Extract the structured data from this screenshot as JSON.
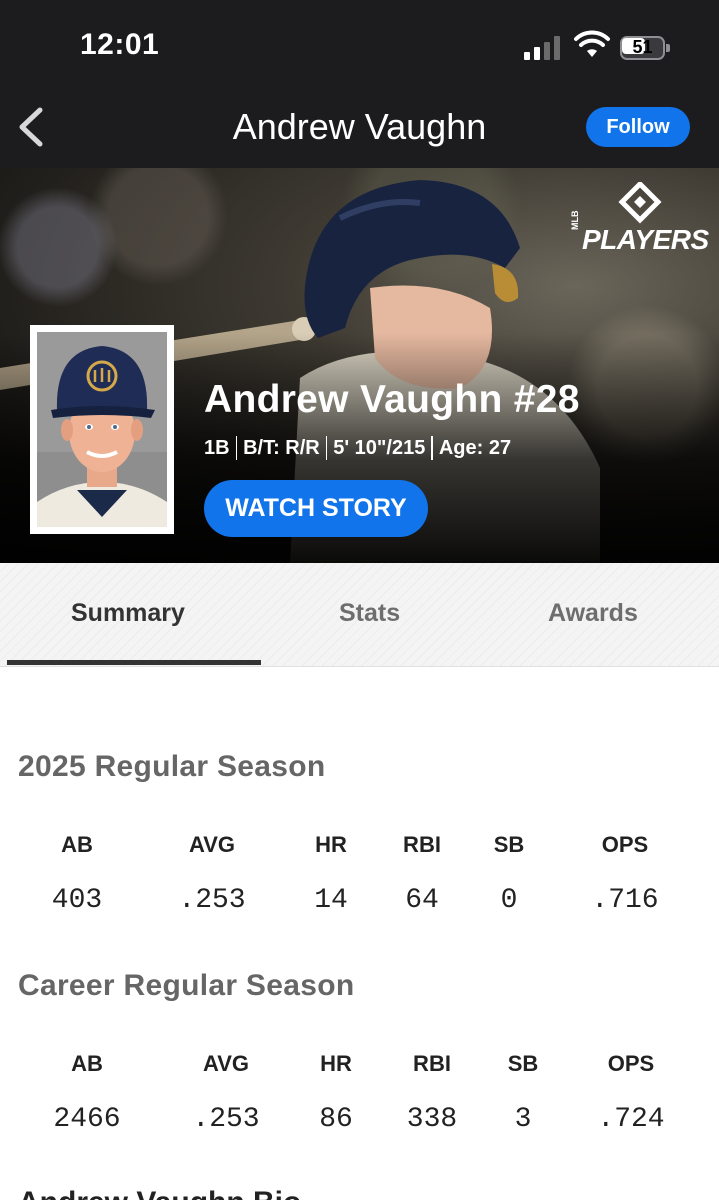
{
  "status_bar": {
    "time": "12:01",
    "battery": "51"
  },
  "nav": {
    "title": "Andrew Vaughn",
    "follow_label": "Follow"
  },
  "hero": {
    "logo_text": "PLAYERS",
    "logo_mlb": "MLB",
    "player_name": "Andrew Vaughn #28",
    "position": "1B",
    "bats_throws": "B/T: R/R",
    "height_weight": "5' 10\"/215",
    "age": "Age: 27",
    "watch_label": "WATCH STORY"
  },
  "tabs": [
    {
      "label": "Summary",
      "active": true
    },
    {
      "label": "Stats",
      "active": false
    },
    {
      "label": "Awards",
      "active": false
    }
  ],
  "season": {
    "title": "2025 Regular Season",
    "headers": [
      "AB",
      "AVG",
      "HR",
      "RBI",
      "SB",
      "OPS"
    ],
    "values": [
      "403",
      ".253",
      "14",
      "64",
      "0",
      ".716"
    ]
  },
  "career": {
    "title": "Career Regular Season",
    "headers": [
      "AB",
      "AVG",
      "HR",
      "RBI",
      "SB",
      "OPS"
    ],
    "values": [
      "2466",
      ".253",
      "86",
      "338",
      "3",
      ".724"
    ]
  },
  "next_section_title": "Andrew Vaughn Bio",
  "colors": {
    "accent": "#1274ea",
    "bar": "#1c1c1e"
  }
}
